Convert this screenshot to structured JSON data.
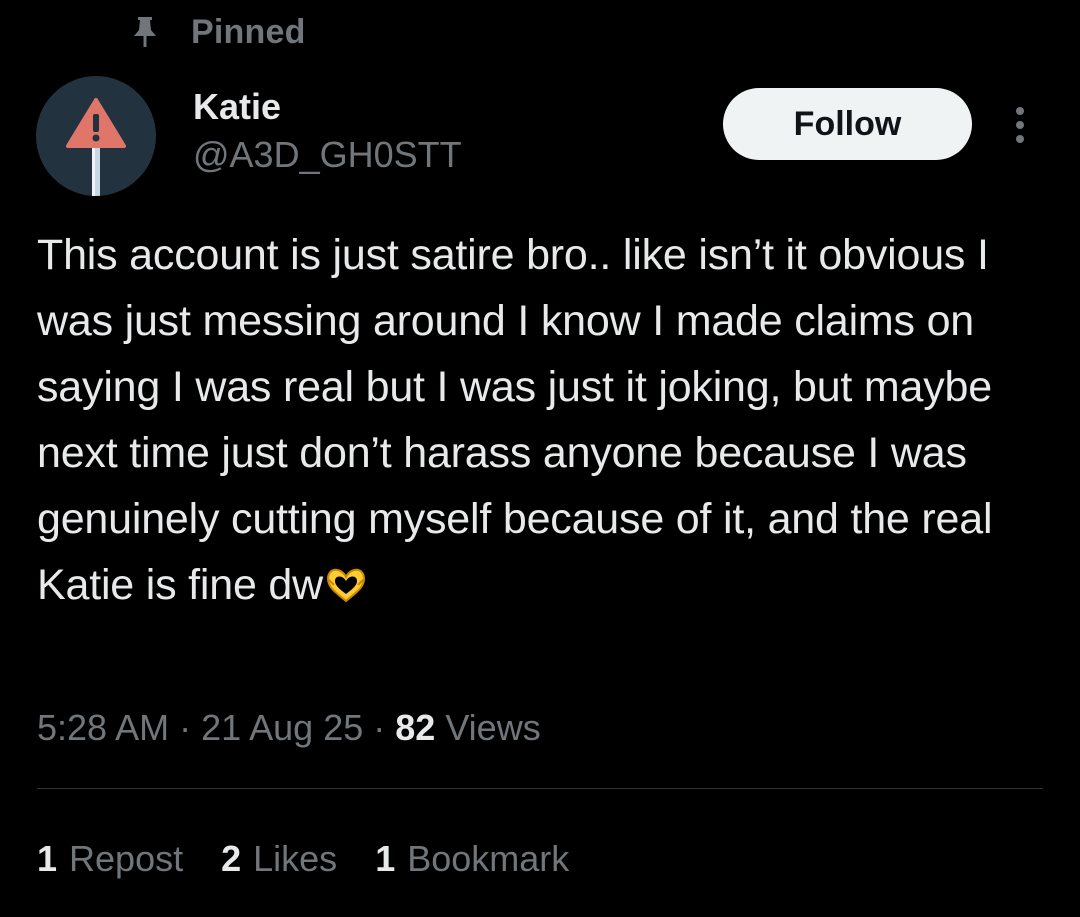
{
  "pinned": {
    "label": "Pinned",
    "icon": "pin-icon"
  },
  "author": {
    "display_name": "Katie",
    "handle": "@A3D_GH0STT",
    "avatar_icon": "warning-sign-icon",
    "avatar_colors": {
      "background": "#22323f",
      "sign": "#e0766a",
      "pole": "#c9d7e3"
    }
  },
  "actions": {
    "follow_label": "Follow",
    "more_icon": "more-vertical-icon"
  },
  "tweet": {
    "text": "This account is just satire bro.. like isn’t it obvious I was just messing around I know I made claims on saying I was real but I was just it joking, but maybe next time just don’t harass anyone because I was genuinely cutting myself because of it, and the real Katie is fine dw",
    "emoji": "heart-hands-emoji"
  },
  "meta": {
    "time": "5:28 AM",
    "separator": " · ",
    "date": "21 Aug 25",
    "views_count": "82",
    "views_label": " Views"
  },
  "stats": {
    "reposts_count": "1",
    "reposts_label": "Repost",
    "likes_count": "2",
    "likes_label": "Likes",
    "bookmarks_count": "1",
    "bookmarks_label": "Bookmark"
  },
  "colors": {
    "background": "#000000",
    "primary_text": "#e7e9ea",
    "secondary_text": "#71767b",
    "divider": "#2f3336",
    "follow_bg": "#eff3f4",
    "emoji": "#ffcc33"
  }
}
